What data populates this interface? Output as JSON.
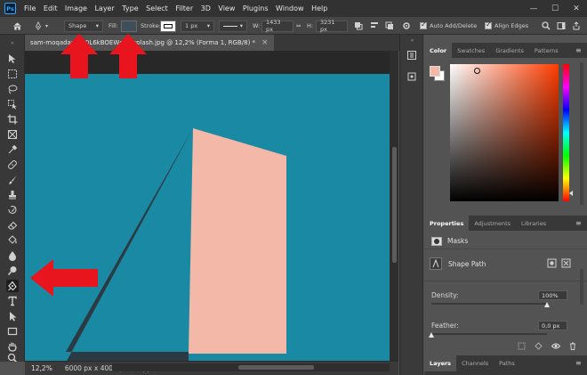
{
  "app": {
    "logo": "Ps"
  },
  "menu": [
    "File",
    "Edit",
    "Image",
    "Layer",
    "Type",
    "Select",
    "Filter",
    "3D",
    "View",
    "Plugins",
    "Window",
    "Help"
  ],
  "window_controls": {
    "minimize": "—",
    "maximize": "☐",
    "close": "✕"
  },
  "options": {
    "mode": "Shape",
    "fill_label": "Fill:",
    "stroke_label": "Stroke:",
    "stroke_width": "1 px",
    "w_label": "W:",
    "w_value": "1433 px",
    "link": "⇔",
    "h_label": "H:",
    "h_value": "3231 px",
    "auto_add_delete": "Auto Add/Delete",
    "align_edges": "Align Edges"
  },
  "document": {
    "tab_title": "sam-moqadam-...0L6kBOEWc-unsplash.jpg @ 12,2% (Forma 1, RGB/8) *",
    "tab_close": "×",
    "zoom": "12,2%",
    "info": "6000 px x 4000 px (72 ppi)",
    "info_arrow": "›"
  },
  "color_panel": {
    "tabs": [
      "Color",
      "Swatches",
      "Gradients",
      "Patterns"
    ],
    "foreground": "#f2b8a8",
    "background": "#ffffff"
  },
  "properties_panel": {
    "tabs": [
      "Properties",
      "Adjustments",
      "Libraries"
    ],
    "masks_label": "Masks",
    "shape_path_label": "Shape Path",
    "density_label": "Density:",
    "density_value": "100%",
    "density": 1.0,
    "feather_label": "Feather:",
    "feather_value": "0,0 px",
    "feather": 0.0
  },
  "layers_panel": {
    "tabs": [
      "Layers",
      "Channels",
      "Paths"
    ]
  },
  "colors": {
    "sky": "#1a8aa4",
    "building_front": "#f3b8a8",
    "building_shadow": "#2c3a44",
    "annotation_arrow": "#e8141e"
  }
}
